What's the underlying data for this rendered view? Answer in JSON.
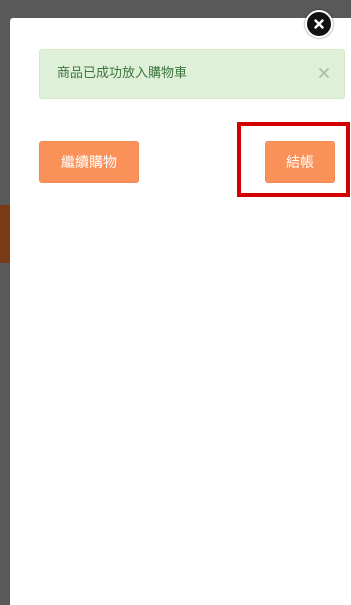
{
  "alert": {
    "message": "商品已成功放入購物車",
    "close_icon": "close-x-icon"
  },
  "buttons": {
    "continue_label": "繼續購物",
    "checkout_label": "結帳"
  },
  "modal": {
    "close_icon": "circle-close-icon"
  },
  "colors": {
    "button_bg": "#fa9158",
    "alert_bg": "#dff0d8",
    "alert_text": "#3c763d",
    "highlight": "#d40000",
    "backdrop": "#595959"
  }
}
